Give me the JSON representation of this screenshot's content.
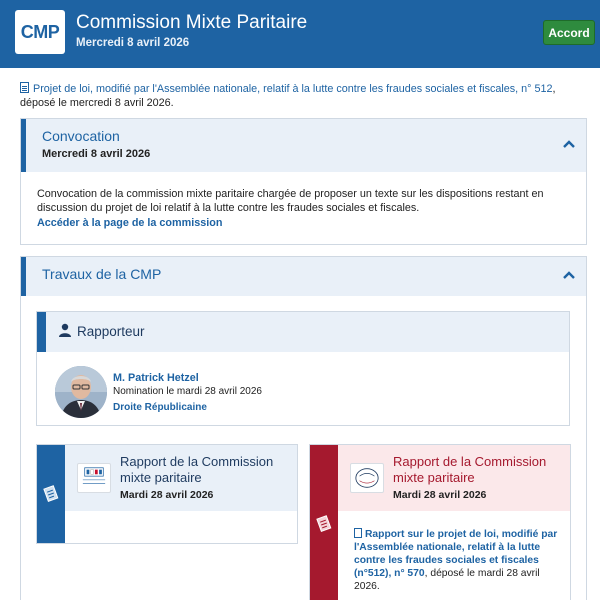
{
  "header": {
    "logo_text": "CMP",
    "title": "Commission Mixte Paritaire",
    "date": "Mercredi 8 avril 2026",
    "status_button": "Accord",
    "colors": {
      "brand": "#1e63a3",
      "accord": "#2e8b3e"
    }
  },
  "intro": {
    "link_text": "Projet de loi, modifié par l'Assemblée nationale, relatif à la lutte contre les fraudes sociales et fiscales, n° 512",
    "suffix": ", déposé le mercredi 8 avril 2026."
  },
  "convocation": {
    "title": "Convocation",
    "date": "Mercredi 8 avril 2026",
    "body": "Convocation de la commission mixte paritaire chargée de proposer un texte sur les dispositions restant en discussion du projet de loi relatif à la lutte contre les fraudes sociales et fiscales.",
    "link": "Accéder à la page de la commission",
    "chevron_icon": "chevron-up-icon"
  },
  "travaux": {
    "title": "Travaux de la CMP",
    "chevron_icon": "chevron-up-icon",
    "rapporteur": {
      "heading": "Rapporteur",
      "icon": "person-icon",
      "name": "M. Patrick Hetzel",
      "nomination": "Nomination le mardi 28 avril 2026",
      "group": "Droite Républicaine"
    },
    "reports": [
      {
        "title": "Rapport de la Commission mixte paritaire",
        "date": "Mardi 28 avril 2026",
        "logo_text": "ASSEMBLÉE NATIONALE",
        "color": "#1e63a3"
      },
      {
        "title": "Rapport de la Commission mixte paritaire",
        "date": "Mardi 28 avril 2026",
        "logo_text": "SÉNAT",
        "color": "#a5192e",
        "description_link": "Rapport sur le projet de loi, modifié par l'Assemblée nationale, relatif à la lutte contre les fraudes sociales et fiscales (n°512), n° 570",
        "description_suffix": ", déposé le mardi 28 avril 2026."
      }
    ]
  }
}
